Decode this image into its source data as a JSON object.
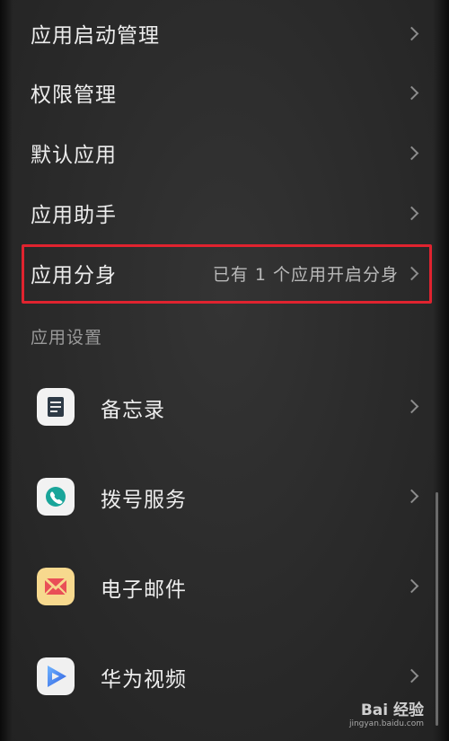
{
  "settings_rows": [
    {
      "label": "应用启动管理"
    },
    {
      "label": "权限管理"
    },
    {
      "label": "默认应用"
    },
    {
      "label": "应用助手"
    },
    {
      "label": "应用分身",
      "value": "已有 1 个应用开启分身"
    }
  ],
  "section": {
    "title": "应用设置"
  },
  "apps": [
    {
      "label": "备忘录",
      "icon": "notepad-icon"
    },
    {
      "label": "拨号服务",
      "icon": "phone-icon"
    },
    {
      "label": "电子邮件",
      "icon": "mail-icon"
    },
    {
      "label": "华为视频",
      "icon": "video-icon"
    }
  ],
  "watermark": {
    "main": "Bai 经验",
    "sub": "jingyan.baidu.com"
  },
  "colors": {
    "highlight": "#e0232f",
    "background": "#2a2a2a"
  }
}
